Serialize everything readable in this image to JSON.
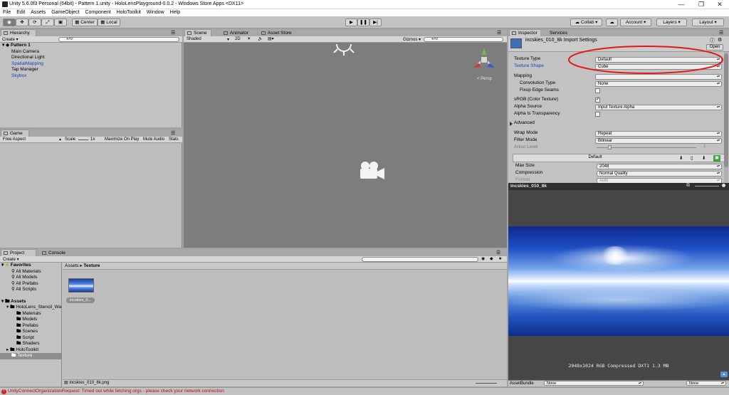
{
  "window": {
    "title": "Unity 5.6.0f3 Personal (64bit) - Pattern 1.unity - HoloLensPlayground-0.0.2 - Windows Store Apps <DX11>",
    "minimize": "—",
    "maximize": "❐",
    "close": "✕"
  },
  "menu": [
    "File",
    "Edit",
    "Assets",
    "GameObject",
    "Component",
    "HoloToolkit",
    "Window",
    "Help"
  ],
  "toolbar": {
    "pivot": "Center",
    "space": "Local",
    "collab": "Collab ▾",
    "account": "Account ▾",
    "layers": "Layers ▾",
    "layout": "Layout ▾"
  },
  "hierarchy": {
    "tab": "Hierarchy",
    "create": "Create ▾",
    "search_placeholder": "●All",
    "scene": "Pattern 1",
    "items": [
      "Main Camera",
      "Directional Light",
      "SpatialMapping",
      "Tap Manager",
      "Skybox"
    ]
  },
  "game": {
    "tab": "Game",
    "aspect": "Free Aspect",
    "scale_label": "Scale",
    "scale_value": "1x",
    "maximize": "Maximize On Play",
    "mute": "Mute Audio",
    "stats": "Stats"
  },
  "scene": {
    "tabs": [
      "Scene",
      "Animator",
      "Asset Store"
    ],
    "shading": "Shaded",
    "mode2d": "2D",
    "gizmos": "Gizmos ▾",
    "search_placeholder": "●All",
    "persp": "< Persp"
  },
  "project": {
    "tabs": [
      "Project",
      "Console"
    ],
    "create": "Create ▾",
    "breadcrumb": [
      "Assets",
      "Texture"
    ],
    "favorites_label": "Favorites",
    "favorites": [
      "All Materials",
      "All Models",
      "All Prefabs",
      "All Scripts"
    ],
    "assets_label": "Assets",
    "assets_tree": [
      "HoloLens_Stencil_Wa",
      "Materials",
      "Models",
      "Prefabs",
      "Scenes",
      "Script",
      "Shaders",
      "HoloToolkit",
      "Texture"
    ],
    "thumb_label": "incskies_0...",
    "footer_file": "incskies_010_8k.png"
  },
  "inspector": {
    "tabs": [
      "Inspector",
      "Services"
    ],
    "asset_title": "incskies_010_8k Import Settings",
    "open": "Open",
    "fields": [
      {
        "label": "Texture Type",
        "value": "Default"
      },
      {
        "label": "Texture Shape",
        "value": "Cube"
      },
      {
        "label": "Mapping",
        "value": ""
      },
      {
        "label": "Convolution Type",
        "value": "None"
      },
      {
        "label": "Fixup Edge Seams",
        "value": ""
      },
      {
        "label": "sRGB (Color Texture)",
        "value": ""
      },
      {
        "label": "Alpha Source",
        "value": "Input Texture Alpha"
      },
      {
        "label": "Alpha Is Transparency",
        "value": ""
      },
      {
        "label": "Advanced",
        "value": ""
      },
      {
        "label": "Wrap Mode",
        "value": "Repeat"
      },
      {
        "label": "Filter Mode",
        "value": "Bilinear"
      },
      {
        "label": "Aniso Level",
        "value": "1"
      }
    ],
    "platform_header": "Default",
    "platform_fields": [
      {
        "label": "Max Size",
        "value": "2048"
      },
      {
        "label": "Compression",
        "value": "Normal Quality"
      },
      {
        "label": "Format",
        "value": "Auto"
      }
    ]
  },
  "preview": {
    "title": "incskies_010_8k",
    "info": "2048x1024  RGB Compressed DXT1   1.3 MB",
    "assetbundle_label": "AssetBundle",
    "bundle_name": "None",
    "bundle_variant": "None"
  },
  "status": {
    "message": "UnityConnectOrganizationRequest: Timed out while fetching orgs - please check your network connection"
  },
  "colors": {
    "highlight_ellipse": "#e01919",
    "selection": "#3d6fb8",
    "link_blue": "#1a3fbf",
    "error_icon": "#d42020"
  }
}
